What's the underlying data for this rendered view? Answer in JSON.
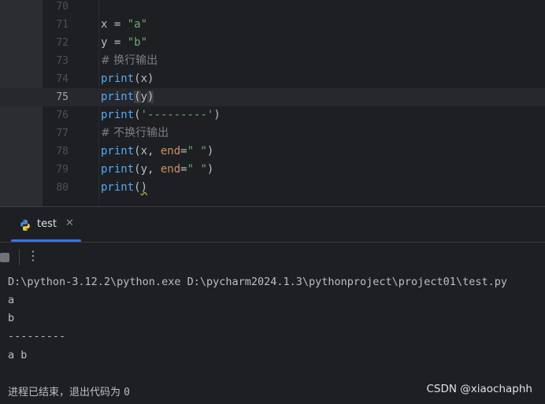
{
  "editor": {
    "lines": [
      {
        "num": "70"
      },
      {
        "num": "71",
        "tokens": [
          "x = ",
          "\"a\""
        ]
      },
      {
        "num": "72",
        "tokens": [
          "y = ",
          "\"b\""
        ]
      },
      {
        "num": "73",
        "comment": "# 换行输出"
      },
      {
        "num": "74",
        "tokens": [
          "print",
          "(x)"
        ]
      },
      {
        "num": "75",
        "tokens": [
          "print",
          "(",
          "y",
          ")"
        ]
      },
      {
        "num": "76",
        "tokens": [
          "print",
          "(",
          "'---------'",
          ")"
        ]
      },
      {
        "num": "77",
        "comment": "# 不换行输出"
      },
      {
        "num": "78",
        "tokens": [
          "print",
          "(x, ",
          "end",
          "=",
          "\" \"",
          ")"
        ]
      },
      {
        "num": "79",
        "tokens": [
          "print",
          "(y, ",
          "end",
          "=",
          "\" \"",
          ")"
        ]
      },
      {
        "num": "80",
        "tokens": [
          "print",
          "(",
          ")"
        ]
      }
    ],
    "current_line": "75"
  },
  "run_panel": {
    "tab_label": "test",
    "close_glyph": "✕",
    "more_glyph": "⋮",
    "icons": {
      "tab": "python-icon",
      "stop": "stop-icon",
      "more": "more-vertical-icon"
    }
  },
  "console": {
    "command": "D:\\python-3.12.2\\python.exe D:\\pycharm2024.1.3\\pythonproject\\project01\\test.py",
    "output": [
      "a",
      "b",
      "---------",
      "a b"
    ],
    "exit_message": "进程已结束，退出代码为 ",
    "exit_code": "0"
  },
  "watermark": "CSDN @xiaochaphh",
  "colors": {
    "background": "#1e1f22",
    "function": "#56a8f5",
    "string": "#6aab73",
    "keyword": "#cf8e6d",
    "comment": "#7a7e85",
    "accent": "#3574f0"
  }
}
